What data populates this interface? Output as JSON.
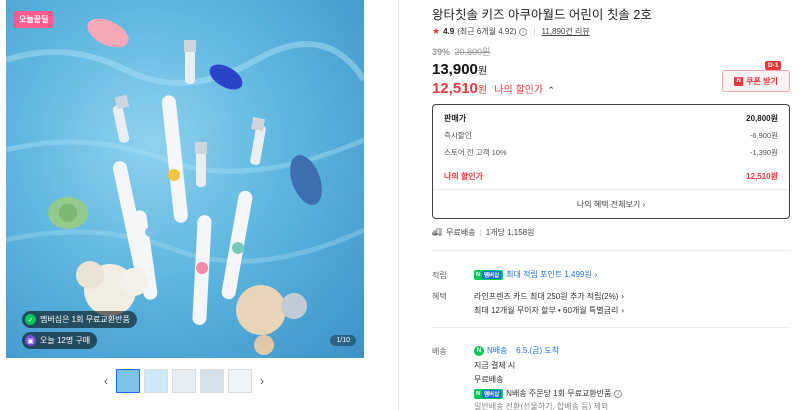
{
  "gallery": {
    "today_badge": "오늘끝딜",
    "membership_pill": "멤버십은 1회 무료교환반품",
    "today_purchases_pill": "오늘 12명 구매",
    "counter": "1/10",
    "prev_icon": "chevron-left-icon",
    "next_icon": "chevron-right-icon",
    "thumbnails": [
      "thumb-1",
      "thumb-2",
      "thumb-3",
      "thumb-4",
      "thumb-5"
    ]
  },
  "product": {
    "title": "왕타칫솔 키즈 아쿠아월드 어린이 칫솔 2호",
    "rating": "4.9",
    "rating_detail": "(최근 6개월 4.92)",
    "reviews": "11,890건 리뷰",
    "discount_rate": "39%",
    "original_price": "20,800원",
    "price": "13,900",
    "price_unit": "원",
    "my_price": "12,510",
    "my_price_unit": "원",
    "my_price_label": "나의 할인가",
    "coupon_label": "쿠폰 받기",
    "dday": "D-1"
  },
  "price_box": {
    "rows": [
      {
        "label": "판매가",
        "value": "20,800원"
      },
      {
        "label": "즉시할인",
        "value": "-6,900원"
      },
      {
        "label": "스토어 전 고객 10%",
        "value": "-1,390원"
      }
    ],
    "my_label": "나의 할인가",
    "my_value": "12,510원",
    "benefits_link": "나의 혜택 전체보기"
  },
  "shipping": {
    "free": "무료배송",
    "per_unit": "1개당 1,158원"
  },
  "points": {
    "label": "적립",
    "npay_text": "N",
    "npay_plus": "멤버십",
    "text": "최대 적립 포인트 1,499원"
  },
  "benefits": {
    "label": "혜택",
    "line1": "라인프렌즈 카드 최대 250원 추가 적립(2%)",
    "line2": "최대 12개월 무이자 할부 • 60개월 특별금리"
  },
  "delivery": {
    "label": "배송",
    "badge": "N배송",
    "date": "6.5.(금) 도착",
    "line1": "지금 결제 시",
    "line2": "무료배송",
    "line3": "N배송 주문당 1회 무료교환반품",
    "line4": "일반배송 전환(선물하기, 합배송 등) 제외"
  },
  "colors": {
    "accent_red": "#f0373e",
    "naver_green": "#03c75a",
    "link_blue": "#1e6fd9"
  }
}
